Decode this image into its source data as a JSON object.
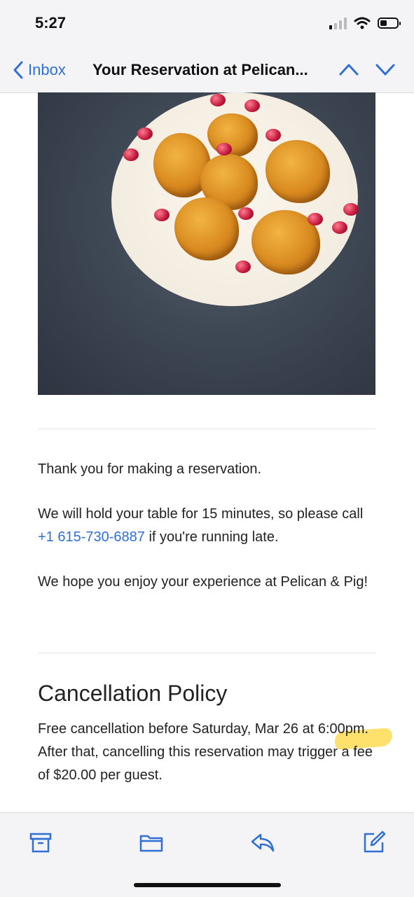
{
  "status_bar": {
    "time": "5:27"
  },
  "nav": {
    "back_label": "Inbox",
    "title": "Your Reservation at Pelican..."
  },
  "email": {
    "image_icon": "food-photo",
    "thanks": "Thank you for making a reservation.",
    "hold_before": "We will hold your table for 15 minutes, so please call ",
    "phone": "+1 615-730-6887",
    "hold_after": " if you're running late.",
    "enjoy": "We hope you enjoy your experience at Pelican & Pig!",
    "policy_heading": "Cancellation Policy",
    "policy_text": "Free cancellation before Saturday, Mar 26 at 6:00pm. After that, cancelling this reservation may trigger a fee of $20.00 per guest."
  },
  "toolbar": {
    "icons": [
      "archive-icon",
      "folder-icon",
      "reply-icon",
      "compose-icon"
    ]
  },
  "colors": {
    "accent": "#2f6fd6",
    "highlight": "#fdd73c"
  }
}
